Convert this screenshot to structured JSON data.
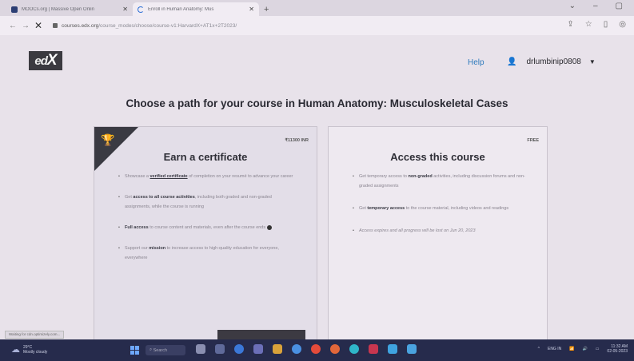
{
  "browser": {
    "tabs": [
      {
        "title": "MOOCs.org | Massive Open Onlin",
        "active": false
      },
      {
        "title": "Enroll in Human Anatomy: Mus",
        "active": true
      }
    ],
    "url_host": "courses.edx.org",
    "url_path": "/course_modes/choose/course-v1:HarvardX+AT1x+2T2023/"
  },
  "header": {
    "logo_text": "ed",
    "logo_x": "X",
    "help": "Help",
    "username": "drlumbinip0808"
  },
  "page_title": "Choose a path for your course in Human Anatomy: Musculoskeletal Cases",
  "cert_card": {
    "price": "₹11300 INR",
    "title": "Earn a certificate",
    "b1_pre": "Showcase a ",
    "b1_link": "verified certificate",
    "b1_post": " of completion on your resumé to advance your career",
    "b2_pre": "Get ",
    "b2_bold": "access to all course activities",
    "b2_post": ", including both graded and non-graded assignments, while the course is running",
    "b3_bold": "Full access",
    "b3_post": " to course content and materials, even after the course ends",
    "b4_pre": "Support our ",
    "b4_bold": "mission",
    "b4_post": " to increase access to high-quality education for everyone, everywhere"
  },
  "free_card": {
    "price": "FREE",
    "title": "Access this course",
    "b1_pre": "Get temporary access to ",
    "b1_bold": "non-graded",
    "b1_post": " activities, including discussion forums and non-graded assignments",
    "b2_pre": "Get ",
    "b2_bold": "temporary access",
    "b2_post": " to the course material, including videos and readings",
    "b3": "Access expires and all progress will be lost on Jun 20, 2023"
  },
  "status_bar": "Waiting for cdn.optimizely.com...",
  "taskbar": {
    "weather_temp": "29°C",
    "weather_desc": "Mostly cloudy",
    "search": "Search",
    "lang": "ENG IN",
    "time": "11:32 AM",
    "date": "02-05-2023"
  },
  "colors": {
    "taskbar": "#262b4c",
    "help_link": "#2f7bbd",
    "corner_banner": "#3a3a42",
    "background": "#e8e2ea"
  }
}
